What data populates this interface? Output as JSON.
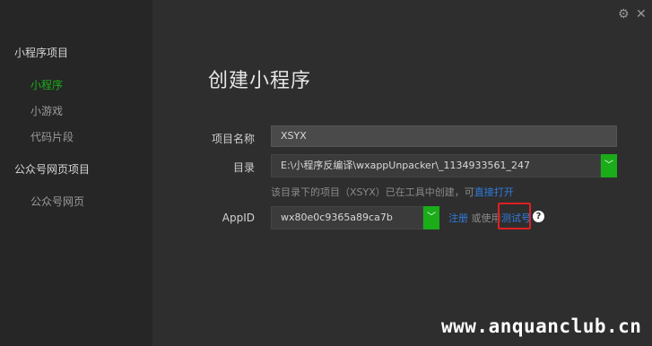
{
  "sidebar": {
    "group1": "小程序项目",
    "items1": [
      "小程序",
      "小游戏",
      "代码片段"
    ],
    "group2": "公众号网页项目",
    "items2": [
      "公众号网页"
    ]
  },
  "window": {
    "settings_icon": "gear-icon",
    "close_icon": "close-icon"
  },
  "main": {
    "title": "创建小程序",
    "project_name_label": "项目名称",
    "project_name_value": "XSYX",
    "dir_label": "目录",
    "dir_value": "E:\\小程序反编译\\wxappUnpacker\\_1134933561_247",
    "dir_hint": "该目录下的项目（XSYX）已在工具中创建，可",
    "dir_hint_link": "直接打开",
    "appid_label": "AppID",
    "appid_value": "wx80e0c9365a89ca7b",
    "register_link": "注册",
    "or_use": "或使用",
    "test_account_link": "测试号",
    "help_symbol": "?"
  },
  "colors": {
    "accent": "#1aad19",
    "link": "#2f7de0",
    "highlight": "#e02020"
  },
  "watermark": "www.anquanclub.cn"
}
